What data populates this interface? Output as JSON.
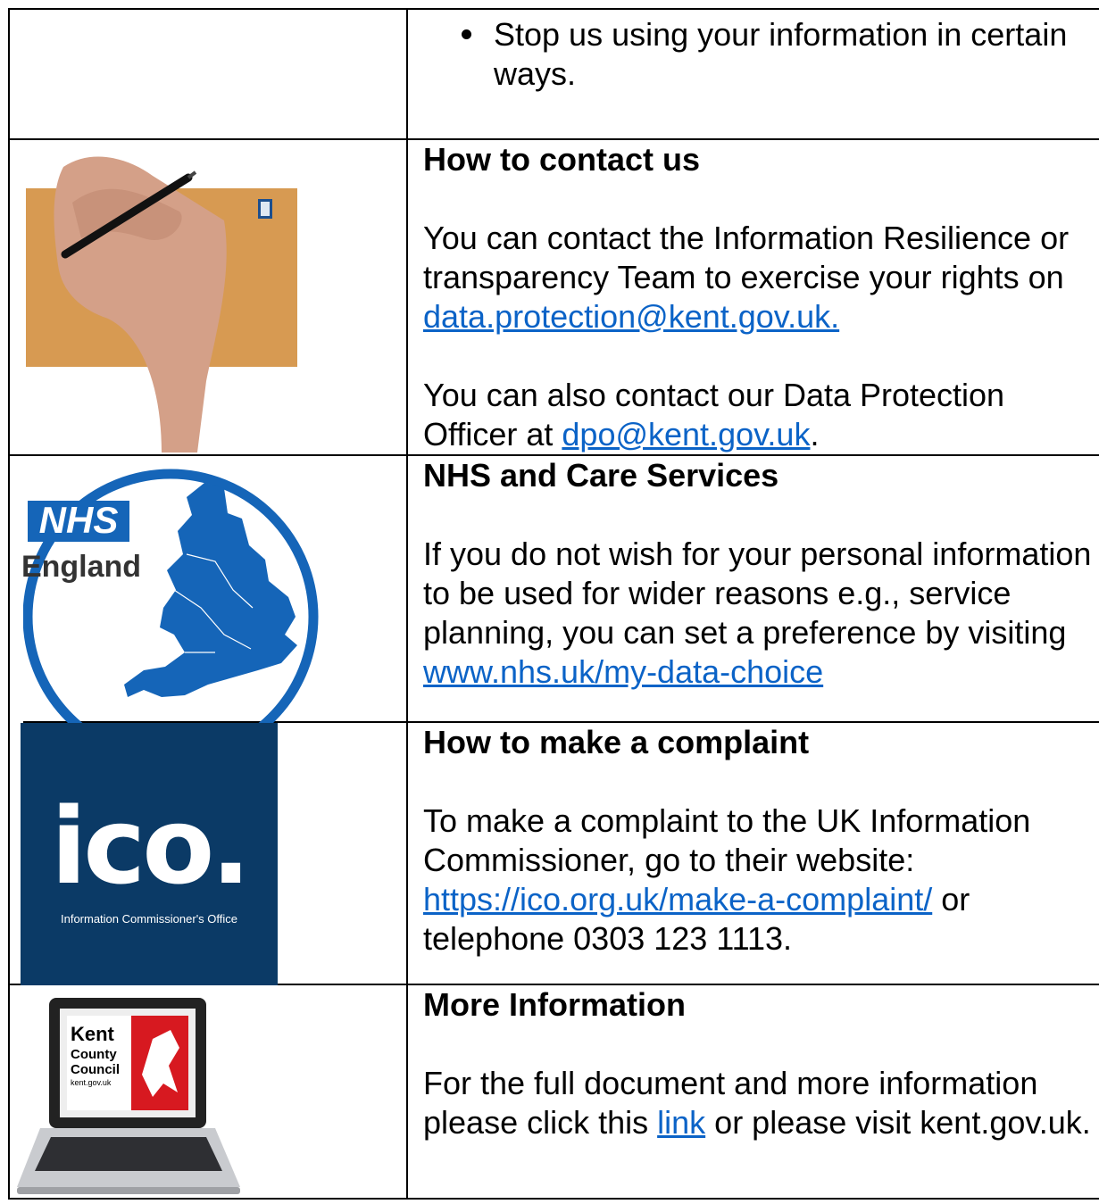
{
  "rows": [
    {
      "bullet": "Stop us using your information in certain ways."
    },
    {
      "heading": "How to contact us",
      "p1_text": "You can contact the Information Resilience or transparency Team to exercise your rights on",
      "p1_link": "data.protection@kent.gov.uk.",
      "p2_text": "You can also contact our Data Protection Officer at",
      "p2_link": "dpo@kent.gov.uk",
      "p2_end": ".",
      "image": "hand-writing-envelope"
    },
    {
      "heading": "NHS and Care Services",
      "p1_text": "If you do not wish for your personal information to be used for wider reasons e.g., service planning, you can set a preference by visiting",
      "p1_link": "www.nhs.uk/my-data-choice",
      "logo_nhs": "NHS",
      "logo_region": "England"
    },
    {
      "heading": "How to make a complaint",
      "p1_text": "To make a complaint to the UK Information Commissioner, go to their website:",
      "p1_link": "https://ico.org.uk/make-a-complaint/",
      "p1_after": "or telephone 0303 123 1113.",
      "logo_ico": "ico.",
      "logo_ico_sub": "Information Commissioner's Office"
    },
    {
      "heading": "More Information",
      "p1_text": "For the full document and more information please click this",
      "p1_link": "link",
      "p1_after": "or please visit kent.gov.uk.",
      "laptop_lines": [
        "Kent",
        "County",
        "Council",
        "kent.gov.uk"
      ]
    }
  ],
  "colors": {
    "link": "#0b63c7",
    "ico_bg": "#0b3a66",
    "nhs_blue": "#1565b8",
    "envelope": "#d79a52",
    "kent_red": "#d71920"
  }
}
